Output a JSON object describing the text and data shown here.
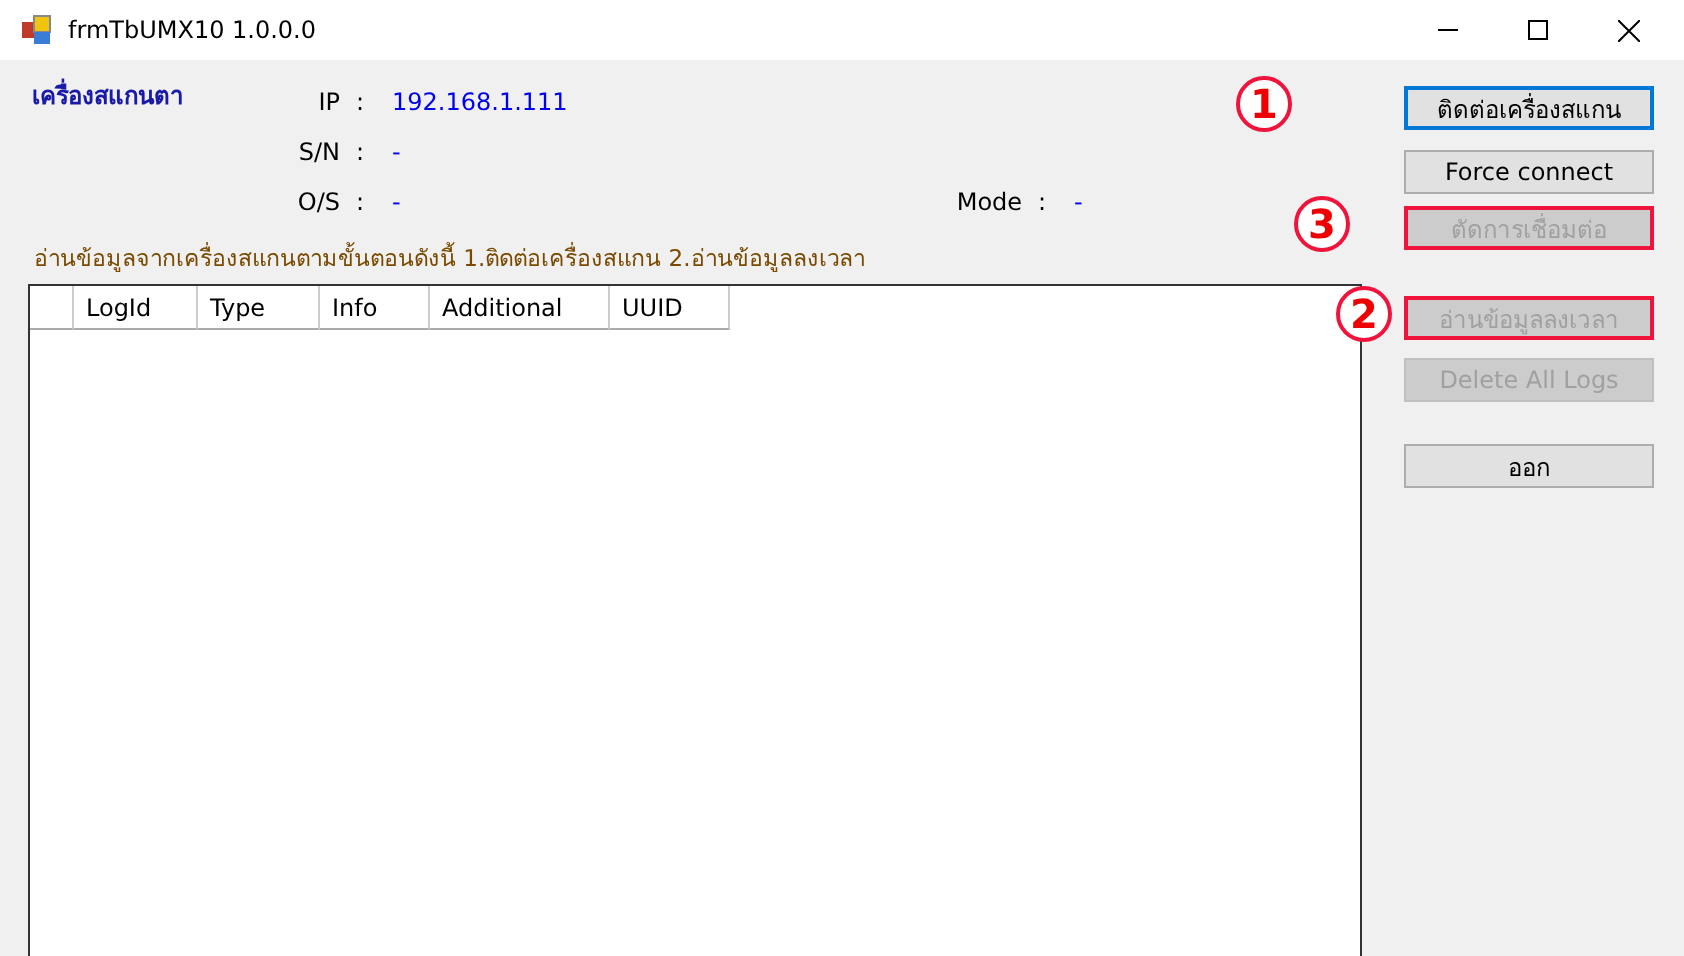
{
  "window": {
    "title": "frmTbUMX10 1.0.0.0"
  },
  "device": {
    "heading": "เครื่องสแกนตา",
    "fields": [
      {
        "label": "IP",
        "value": "192.168.1.111"
      },
      {
        "label": "S/N",
        "value": "-"
      },
      {
        "label": "O/S",
        "value": "-"
      }
    ],
    "mode": {
      "label": "Mode",
      "value": "-"
    }
  },
  "colon": ":",
  "instruction": "อ่านข้อมูลจากเครื่องสแกนตามขั้นตอนดังนี้ 1.ติดต่อเครื่องสแกน 2.อ่านข้อมูลลงเวลา",
  "table": {
    "columns": [
      "LogId",
      "Type",
      "Info",
      "Additional",
      "UUID"
    ]
  },
  "buttons": [
    {
      "label": "ติดต่อเครื่องสแกน",
      "disabled": false,
      "focused": true,
      "highlighted": false,
      "callout": "1"
    },
    {
      "label": "Force connect",
      "disabled": false,
      "focused": false,
      "highlighted": false
    },
    {
      "label": "ตัดการเชื่อมต่อ",
      "disabled": true,
      "focused": false,
      "highlighted": true,
      "callout": "3"
    },
    {
      "label": "อ่านข้อมูลลงเวลา",
      "disabled": true,
      "focused": false,
      "highlighted": true,
      "callout": "2"
    },
    {
      "label": "Delete All Logs",
      "disabled": true,
      "focused": false,
      "highlighted": false
    },
    {
      "label": "ออก",
      "disabled": false,
      "focused": false,
      "highlighted": false
    }
  ]
}
